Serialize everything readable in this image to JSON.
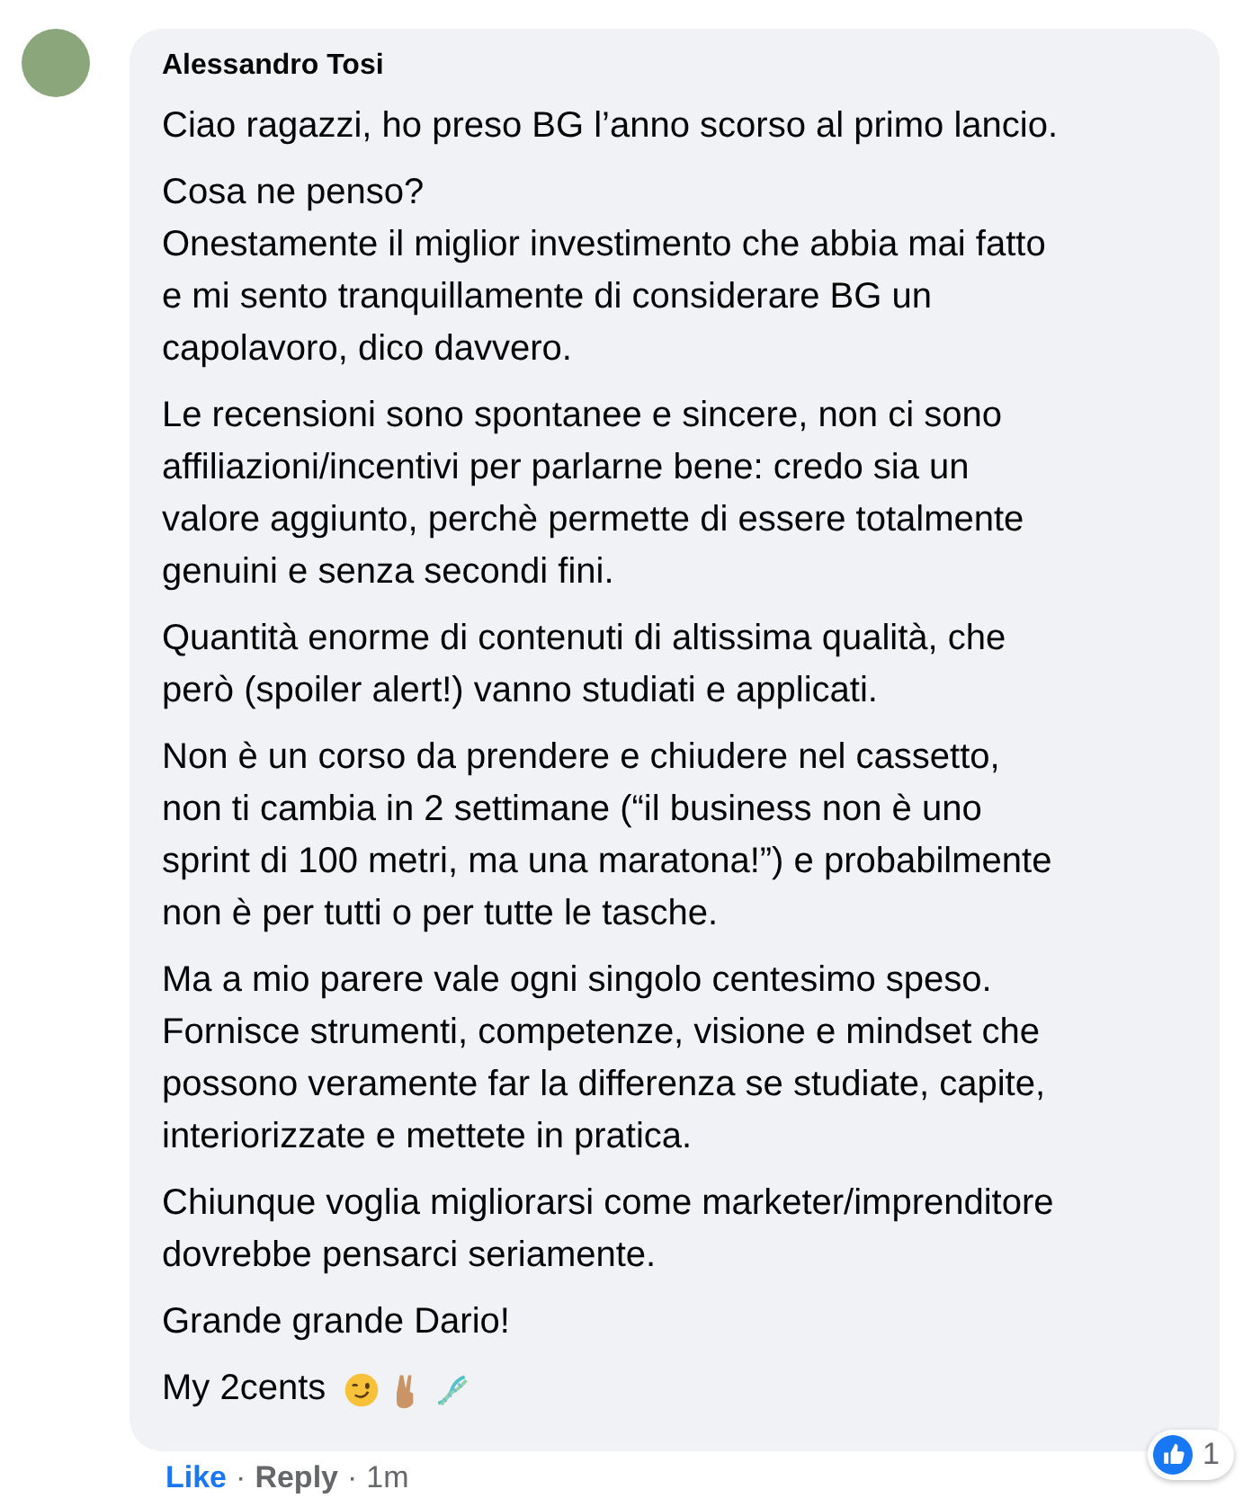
{
  "comment": {
    "author": "Alessandro Tosi",
    "paragraphs": [
      {
        "lines": [
          "Ciao ragazzi, ho preso BG l’anno scorso al primo lancio."
        ]
      },
      {
        "lines": [
          "Cosa ne penso?",
          "Onestamente il miglior investimento che abbia mai fatto",
          "e mi sento tranquillamente di considerare BG un",
          "capolavoro, dico davvero."
        ]
      },
      {
        "lines": [
          "Le recensioni sono spontanee e sincere, non ci sono",
          "affiliazioni/incentivi per parlarne bene: credo sia un",
          "valore aggiunto, perchè permette di essere totalmente",
          "genuini e senza secondi fini."
        ]
      },
      {
        "lines": [
          "Quantità enorme di contenuti di altissima qualità, che",
          "però (spoiler alert!) vanno studiati e applicati."
        ]
      },
      {
        "lines": [
          "Non è un corso da prendere e chiudere nel cassetto,",
          "non ti cambia in 2 settimane (“il business non è uno",
          "sprint di 100 metri, ma una maratona!”) e probabilmente",
          "non è per tutti o per tutte le tasche."
        ]
      },
      {
        "lines": [
          "Ma a mio parere vale ogni singolo centesimo speso.",
          "Fornisce strumenti, competenze, visione e mindset che",
          "possono veramente far la differenza se studiate, capite,",
          "interiorizzate e mettete in pratica."
        ]
      },
      {
        "lines": [
          "Chiunque voglia migliorarsi come marketer/imprenditore",
          "dovrebbe pensarci seriamente."
        ]
      },
      {
        "lines": [
          "Grande grande Dario!"
        ]
      },
      {
        "lines": [
          "My 2cents"
        ],
        "emojis": [
          {
            "kind": "wink"
          },
          {
            "kind": "peace"
          },
          {
            "kind": "dna"
          }
        ]
      }
    ],
    "reaction_count": "1",
    "actions": [
      {
        "label": "Like",
        "kind": "link"
      },
      {
        "label": "·",
        "kind": "sep"
      },
      {
        "label": "Reply",
        "kind": "link"
      },
      {
        "label": "·",
        "kind": "sep"
      },
      {
        "label": "1m",
        "kind": "time"
      }
    ]
  }
}
